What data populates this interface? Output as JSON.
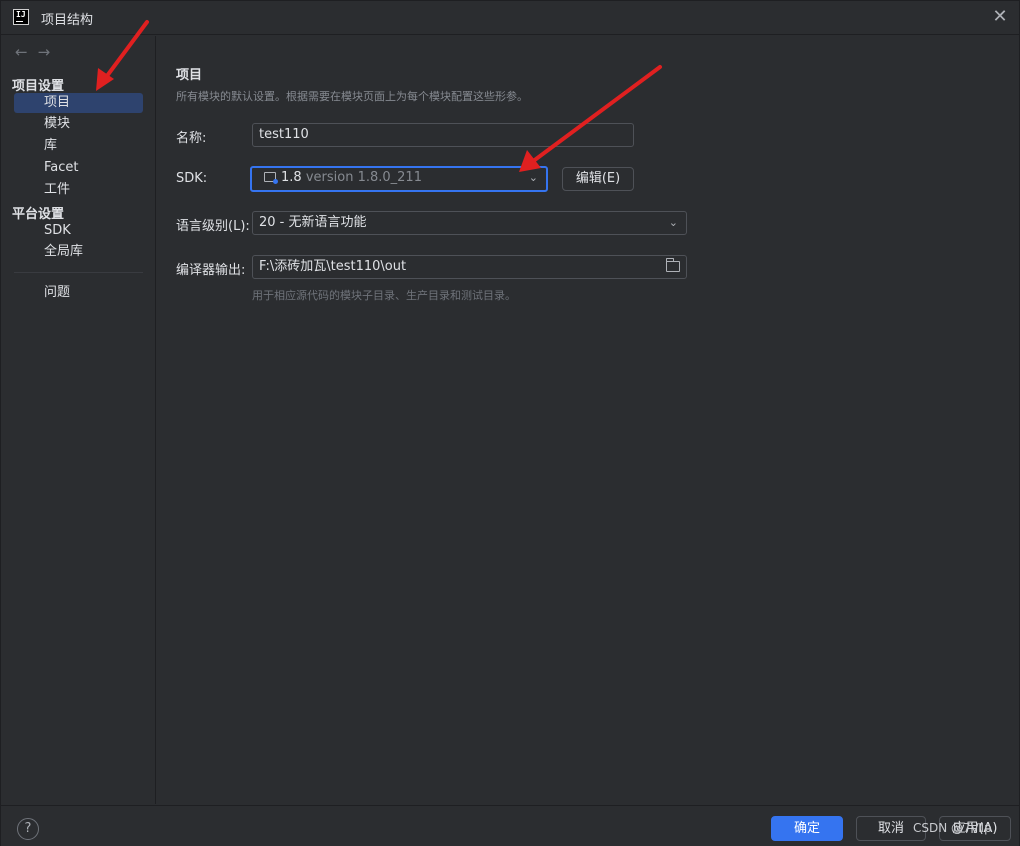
{
  "window": {
    "title": "项目结构",
    "logo_text": "IJ"
  },
  "sidebar": {
    "nav_back": "←",
    "nav_forward": "→",
    "section_project_settings": "项目设置",
    "section_platform_settings": "平台设置",
    "items": [
      {
        "label": "项目",
        "active": true
      },
      {
        "label": "模块"
      },
      {
        "label": "库"
      },
      {
        "label": "Facet"
      },
      {
        "label": "工件"
      }
    ],
    "platform_items": [
      {
        "label": "SDK"
      },
      {
        "label": "全局库"
      }
    ],
    "problems": "问题"
  },
  "main": {
    "title": "项目",
    "subtitle": "所有模块的默认设置。根据需要在模块页面上为每个模块配置这些形参。",
    "name_label": "名称:",
    "name_value": "test110",
    "sdk_label": "SDK:",
    "sdk_name": "1.8",
    "sdk_version": "version 1.8.0_211",
    "edit_button": "编辑(E)",
    "lang_label": "语言级别(L):",
    "lang_value": "20 - 无新语言功能",
    "output_label": "编译器输出:",
    "output_value": "F:\\添砖加瓦\\test110\\out",
    "output_hint": "用于相应源代码的模块子目录、生产目录和测试目录。"
  },
  "footer": {
    "help": "?",
    "ok": "确定",
    "cancel": "取消",
    "apply": "应用(A)",
    "watermark": "CSDN @7Ⅶp"
  },
  "colors": {
    "background": "#2b2d30",
    "accent": "#3574f0",
    "selection": "#2e436e",
    "annotation_arrow": "#e02020"
  },
  "icons": [
    "app-logo-icon",
    "close-icon",
    "back-arrow-icon",
    "forward-arrow-icon",
    "sdk-folder-icon",
    "chevron-down-icon",
    "folder-icon",
    "help-icon"
  ]
}
